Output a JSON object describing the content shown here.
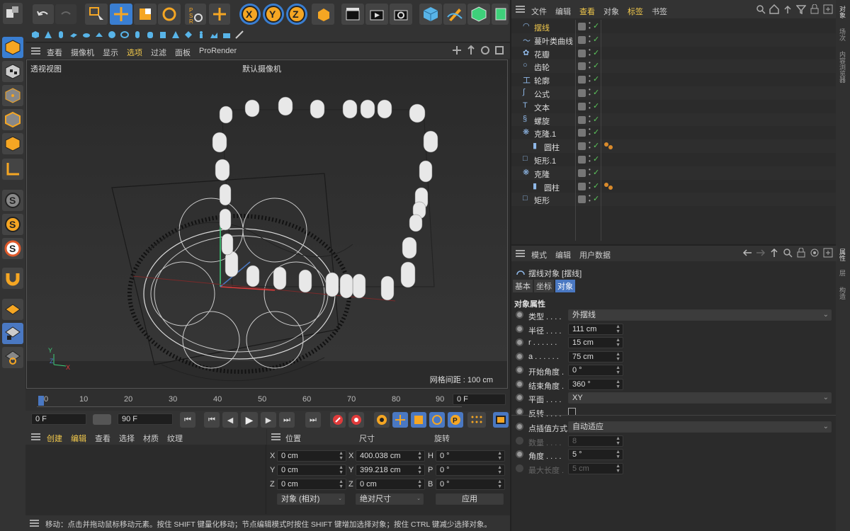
{
  "colors": {
    "accent": "#f2c94c",
    "check": "#5bc65b",
    "toolbar_blue": "#3a7ed1",
    "selected_blue": "#4a78c2"
  },
  "menubar": {
    "items": [
      "查看",
      "摄像机",
      "显示",
      "选项",
      "过滤",
      "面板",
      "ProRender"
    ],
    "selected": "选项"
  },
  "viewport": {
    "label": "透视视图",
    "camera": "默认摄像机",
    "grid_spacing": "网格间距 : 100 cm"
  },
  "timeline": {
    "ticks": [
      "0",
      "10",
      "20",
      "30",
      "40",
      "50",
      "60",
      "70",
      "80",
      "90"
    ],
    "current_frame": "0 F",
    "start": "0 F",
    "end": "90 F"
  },
  "materials": {
    "menu": [
      "创建",
      "编辑",
      "查看",
      "选择",
      "材质",
      "纹理"
    ]
  },
  "coords": {
    "headers": [
      "位置",
      "尺寸",
      "旋转"
    ],
    "rows": [
      {
        "axis": "X",
        "pos": "0 cm",
        "size_axis": "X",
        "size": "400.038 cm",
        "rot_axis": "H",
        "rot": "0 °"
      },
      {
        "axis": "Y",
        "pos": "0 cm",
        "size_axis": "Y",
        "size": "399.218 cm",
        "rot_axis": "P",
        "rot": "0 °"
      },
      {
        "axis": "Z",
        "pos": "0 cm",
        "size_axis": "Z",
        "size": "0 cm",
        "rot_axis": "B",
        "rot": "0 °"
      }
    ],
    "mode": "对象 (相对)",
    "size_mode": "绝对尺寸",
    "apply": "应用"
  },
  "status": "移动：点击并拖动鼠标移动元素。按住 SHIFT 键量化移动；节点编辑模式时按住 SHIFT 键增加选择对象；按住 CTRL 键减少选择对象。",
  "objects": {
    "menu": [
      "文件",
      "编辑",
      "查看",
      "对象",
      "标签",
      "书签"
    ],
    "items": [
      {
        "name": "摆线",
        "icon": "cycloid-icon",
        "indent": 0,
        "selected": true
      },
      {
        "name": "蔓叶类曲线",
        "icon": "cissoid-icon",
        "indent": 0
      },
      {
        "name": "花瓣",
        "icon": "flower-icon",
        "indent": 0
      },
      {
        "name": "齿轮",
        "icon": "gear-icon",
        "indent": 0
      },
      {
        "name": "轮廓",
        "icon": "profile-icon",
        "indent": 0
      },
      {
        "name": "公式",
        "icon": "formula-icon",
        "indent": 0
      },
      {
        "name": "文本",
        "icon": "text-icon",
        "indent": 0
      },
      {
        "name": "螺旋",
        "icon": "helix-icon",
        "indent": 0
      },
      {
        "name": "克隆.1",
        "icon": "cloner-icon",
        "indent": 0
      },
      {
        "name": "圆柱",
        "icon": "cylinder-icon",
        "indent": 1,
        "tag": true
      },
      {
        "name": "矩形.1",
        "icon": "rectangle-icon",
        "indent": 0
      },
      {
        "name": "克隆",
        "icon": "cloner-icon",
        "indent": 0
      },
      {
        "name": "圆柱",
        "icon": "cylinder-icon",
        "indent": 1,
        "tag": true
      },
      {
        "name": "矩形",
        "icon": "rectangle-icon",
        "indent": 0
      }
    ]
  },
  "right_tabs_top": [
    "对象",
    "场次",
    "内容浏览器"
  ],
  "right_tabs_bottom": [
    "属性",
    "层",
    "构造"
  ],
  "attributes": {
    "menu": [
      "模式",
      "编辑",
      "用户数据"
    ],
    "title": "摆线对象 [摆线]",
    "tabs": [
      "基本",
      "坐标",
      "对象"
    ],
    "active_tab": "对象",
    "section": "对象属性",
    "fields": [
      {
        "label": "类型 . . . .",
        "value": "外摆线",
        "kind": "dropdown"
      },
      {
        "label": "半径 . . . .",
        "value": "111 cm",
        "kind": "spin"
      },
      {
        "label": "r . . . . . .",
        "value": "15 cm",
        "kind": "spin"
      },
      {
        "label": "a . . . . . .",
        "value": "75 cm",
        "kind": "spin"
      },
      {
        "label": "开始角度 .",
        "value": "0 °",
        "kind": "spin"
      },
      {
        "label": "结束角度 .",
        "value": "360 °",
        "kind": "spin"
      },
      {
        "label": "平面 . . . .",
        "value": "XY",
        "kind": "dropdown"
      },
      {
        "label": "反转 . . . .",
        "value": "",
        "kind": "checkbox"
      }
    ],
    "fields2": [
      {
        "label": "点插值方式",
        "value": "自动适应",
        "kind": "dropdown"
      },
      {
        "label": "数量 . . . .",
        "value": "8",
        "kind": "spin",
        "disabled": true
      },
      {
        "label": "角度 . . . .",
        "value": "5 °",
        "kind": "spin"
      },
      {
        "label": "最大长度 .",
        "value": "5 cm",
        "kind": "spin",
        "disabled": true
      }
    ]
  }
}
